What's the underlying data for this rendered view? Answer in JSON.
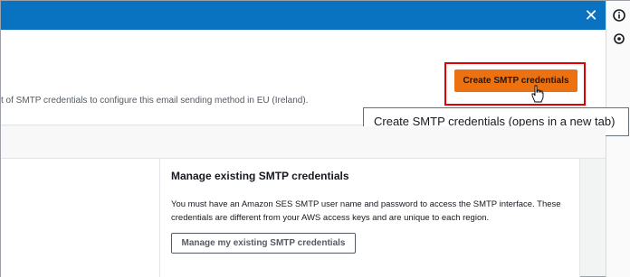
{
  "header": {
    "close_icon": "close-icon"
  },
  "rail": {
    "icons": [
      "info-icon",
      "settings-icon"
    ]
  },
  "upper": {
    "description": "t of SMTP credentials to configure this email sending method in EU (Ireland).",
    "create_button_label": "Create SMTP credentials",
    "tooltip": "Create SMTP credentials (opens in a new tab)"
  },
  "manage": {
    "title": "Manage existing SMTP credentials",
    "text": "You must have an Amazon SES SMTP user name and password to access the SMTP interface. These credentials are different from your AWS access keys and are unique to each region.",
    "button_label": "Manage my existing SMTP credentials"
  },
  "colors": {
    "topbar": "#0a73c1",
    "primary_button": "#ec7211",
    "highlight_box": "#e00000"
  }
}
